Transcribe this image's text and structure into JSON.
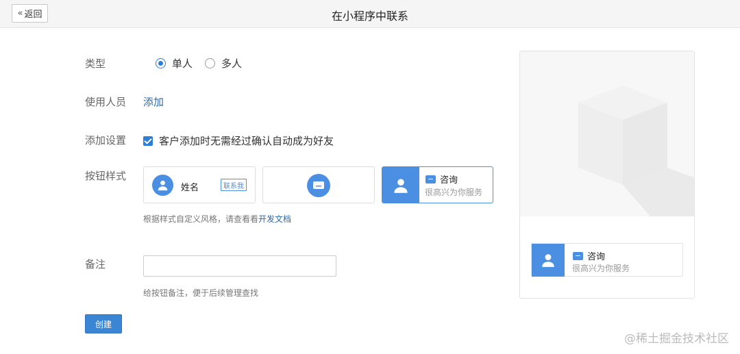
{
  "header": {
    "back_label": "返回",
    "title": "在小程序中联系"
  },
  "form": {
    "type_label": "类型",
    "type_options": [
      "单人",
      "多人"
    ],
    "type_selected": "单人",
    "users_label": "使用人员",
    "users_add_link": "添加",
    "settings_label": "添加设置",
    "settings_checkbox": "客户添加时无需经过确认自动成为好友",
    "settings_checked": true,
    "button_style_label": "按钮样式",
    "style_card1": {
      "name": "姓名",
      "tag": "联系我"
    },
    "style_card3": {
      "title": "咨询",
      "subtitle": "很高兴为你服务"
    },
    "style_hint_prefix": "根据样式自定义风格，请查看看",
    "style_hint_link": "开发文档",
    "note_label": "备注",
    "note_value": "",
    "note_hint": "给按钮备注，便于后续管理查找",
    "create_button": "创建"
  },
  "preview": {
    "title": "咨询",
    "subtitle": "很高兴为你服务"
  },
  "watermark": "@稀土掘金技术社区",
  "colors": {
    "accent": "#4a8fe2",
    "link": "#2b6aa8",
    "button": "#3a86d4"
  }
}
